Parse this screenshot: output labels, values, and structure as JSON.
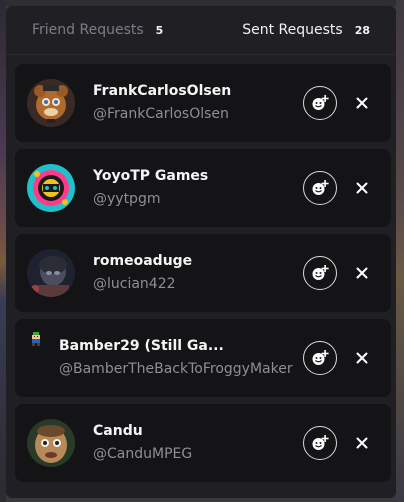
{
  "tabs": {
    "friend_requests": {
      "label": "Friend Requests",
      "count": "5"
    },
    "sent_requests": {
      "label": "Sent Requests",
      "count": "28"
    }
  },
  "requests": [
    {
      "name": "FrankCarlosOlsen",
      "handle": "@FrankCarlosOlsen"
    },
    {
      "name": "YoyoTP Games",
      "handle": "@yytpgm"
    },
    {
      "name": "romeoaduge",
      "handle": "@lucian422"
    },
    {
      "name": "Bamber29 (Still Ga...",
      "handle": "@BamberTheBackToFroggyMaker"
    },
    {
      "name": "Candu",
      "handle": "@CanduMPEG"
    }
  ],
  "icons": {
    "add": "add-friend-icon",
    "remove": "close-icon"
  },
  "colors": {
    "panel": "#202024",
    "card": "#141416",
    "text_primary": "#f5f5f5",
    "text_secondary": "#8e8e96"
  }
}
